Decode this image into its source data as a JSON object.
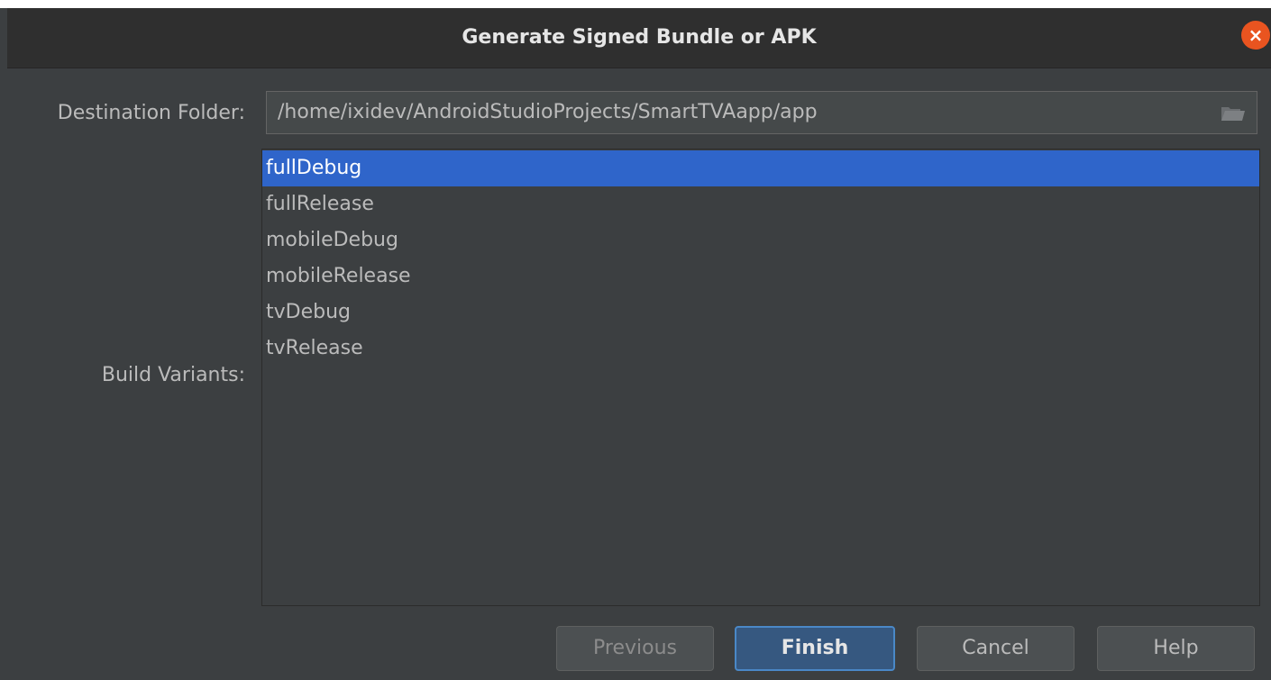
{
  "window": {
    "title": "Generate Signed Bundle or APK",
    "close_glyph": "×"
  },
  "destination": {
    "label": "Destination Folder:",
    "value": "/home/ixidev/AndroidStudioProjects/SmartTVAapp/app",
    "browse_icon": "folder-icon"
  },
  "build_variants": {
    "label": "Build Variants:",
    "items": [
      {
        "label": "fullDebug",
        "selected": true
      },
      {
        "label": "fullRelease",
        "selected": false
      },
      {
        "label": "mobileDebug",
        "selected": false
      },
      {
        "label": "mobileRelease",
        "selected": false
      },
      {
        "label": "tvDebug",
        "selected": false
      },
      {
        "label": "tvRelease",
        "selected": false
      }
    ]
  },
  "buttons": {
    "previous": "Previous",
    "finish": "Finish",
    "cancel": "Cancel",
    "help": "Help"
  },
  "colors": {
    "background": "#3c3f41",
    "titlebar": "#2f2f2f",
    "selection": "#2f65ca",
    "close": "#e95420",
    "default_button": "#365880"
  }
}
